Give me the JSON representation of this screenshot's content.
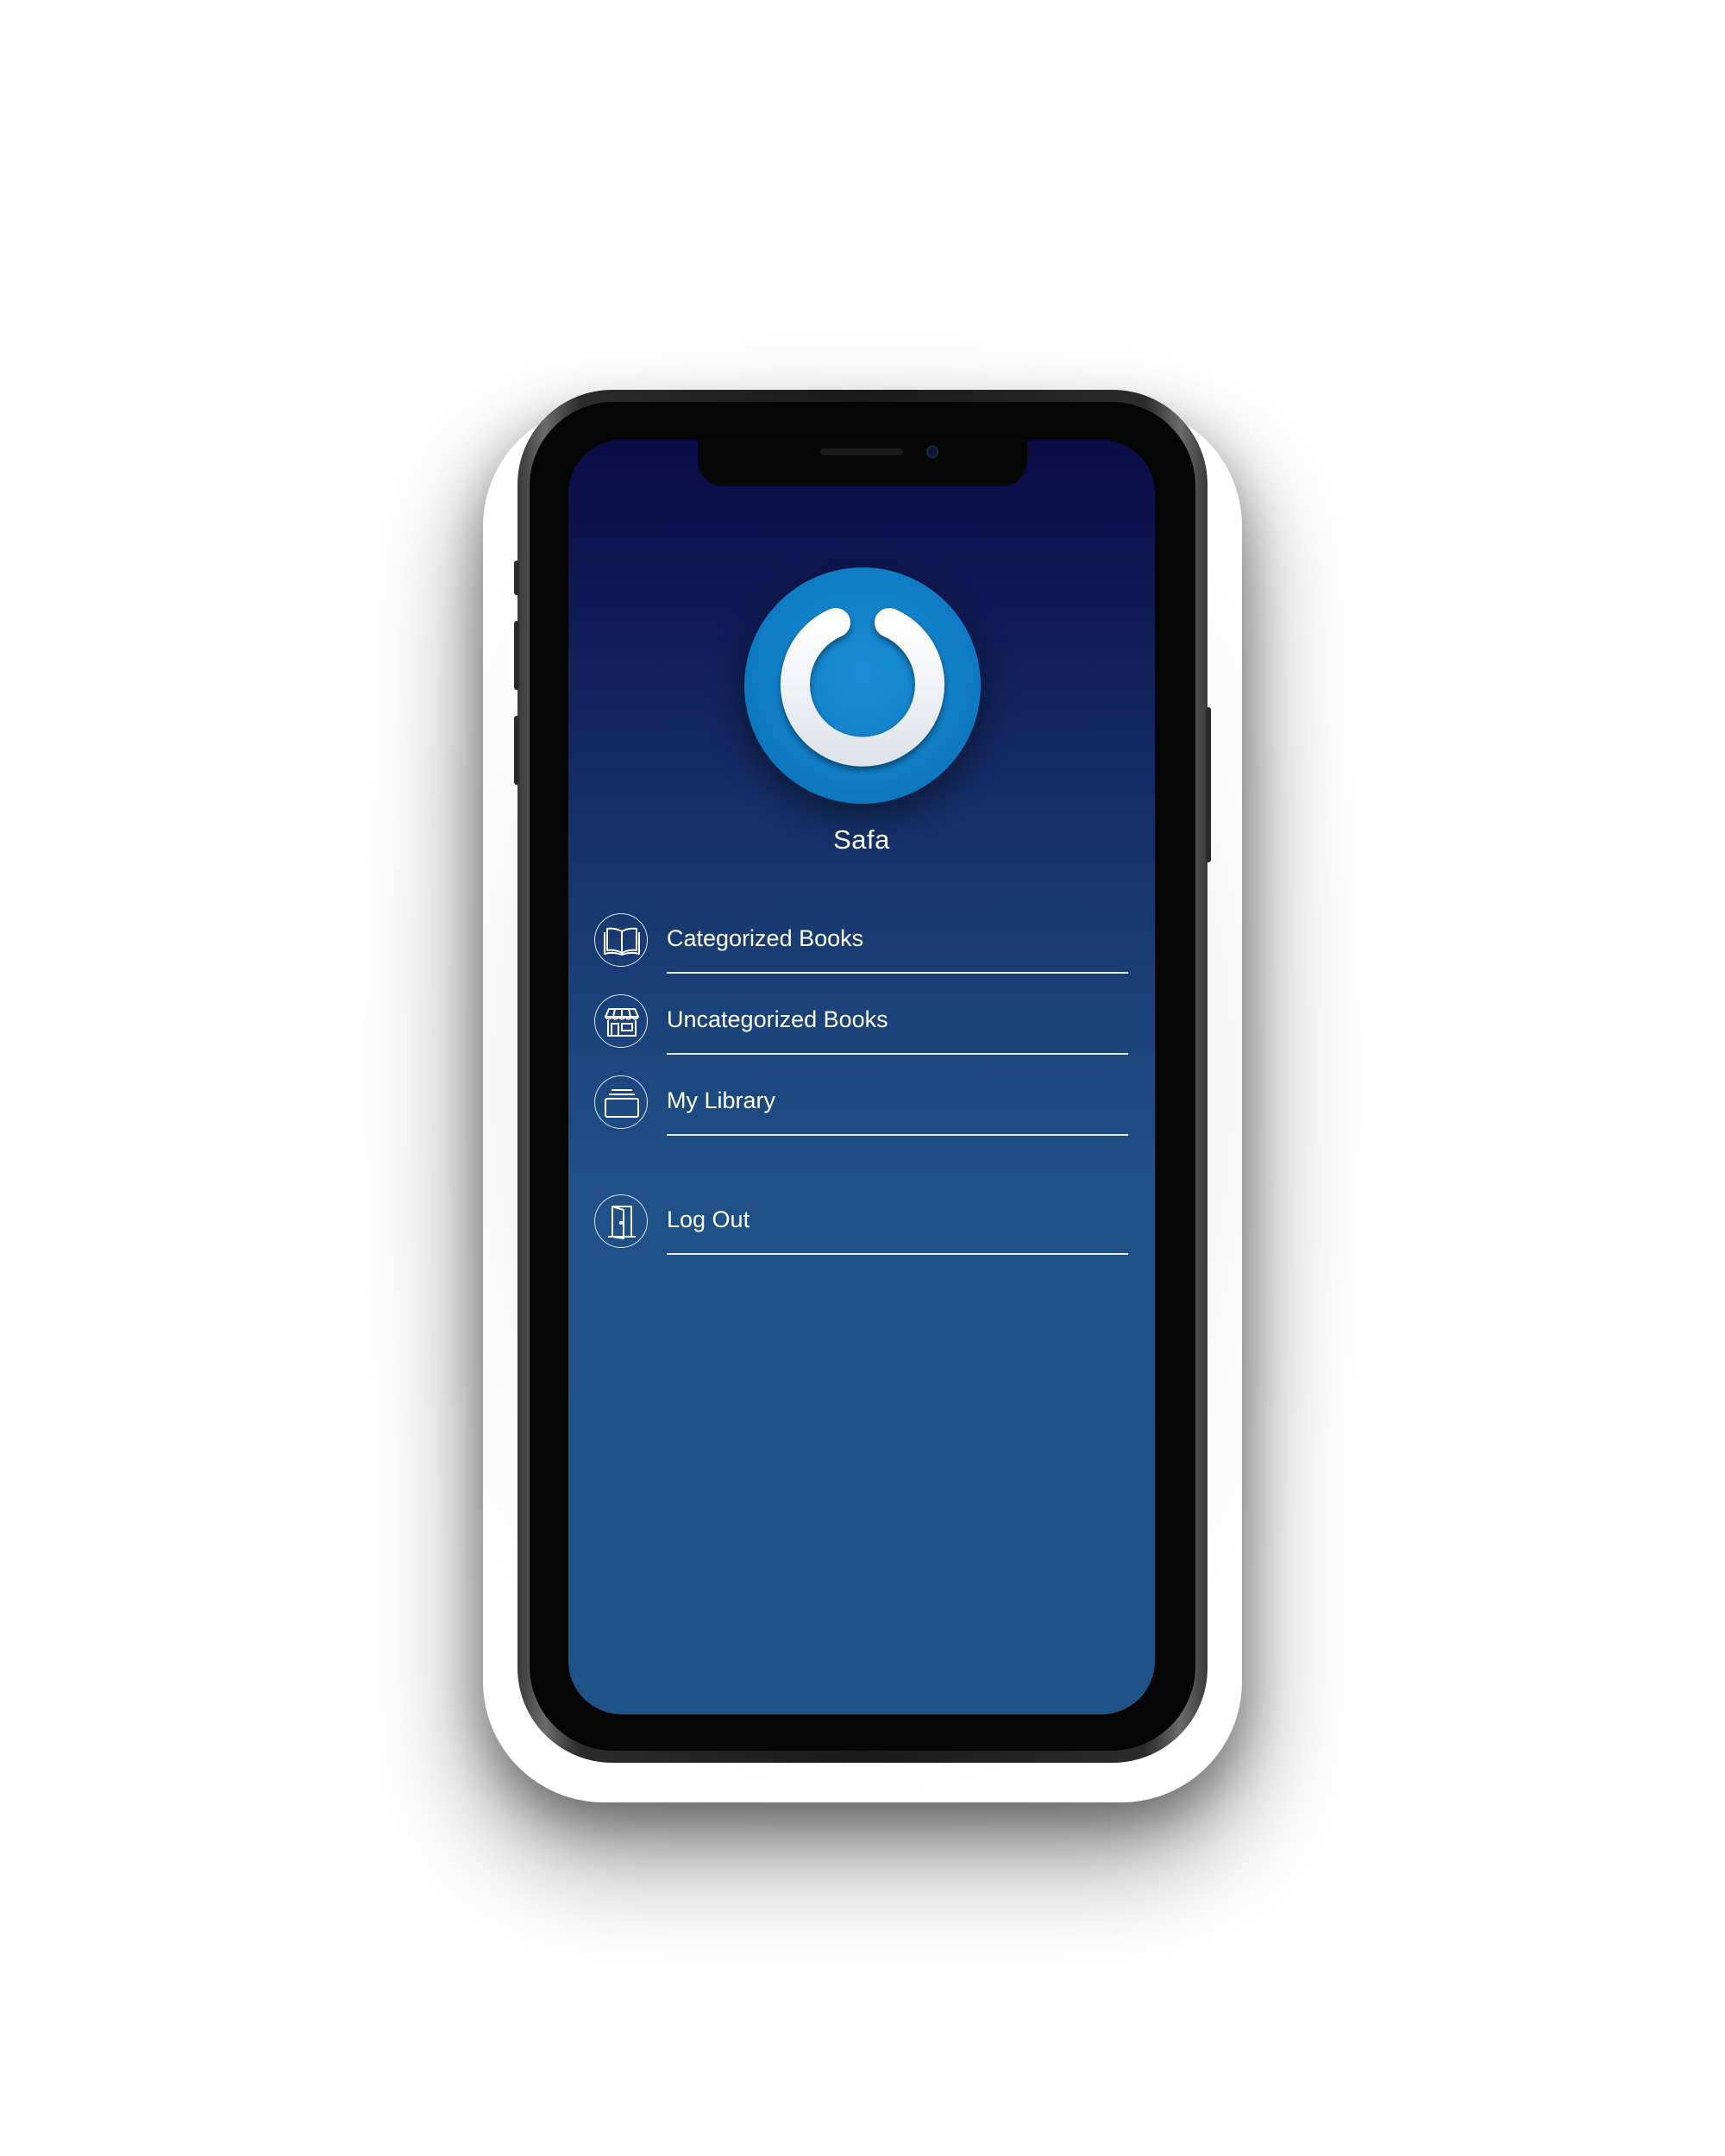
{
  "app": {
    "user_name": "Safa",
    "logo_icon": "power-icon",
    "colors": {
      "screen_top": "#0b0a46",
      "screen_bottom": "#1f5387",
      "logo_blue": "#0f7cc4",
      "text": "#ffffff"
    }
  },
  "menu": {
    "items": [
      {
        "label": "Categorized Books",
        "icon": "open-book-icon"
      },
      {
        "label": "Uncategorized Books",
        "icon": "store-icon"
      },
      {
        "label": "My Library",
        "icon": "archive-box-icon"
      },
      {
        "label": "Log Out",
        "icon": "door-icon"
      }
    ]
  }
}
